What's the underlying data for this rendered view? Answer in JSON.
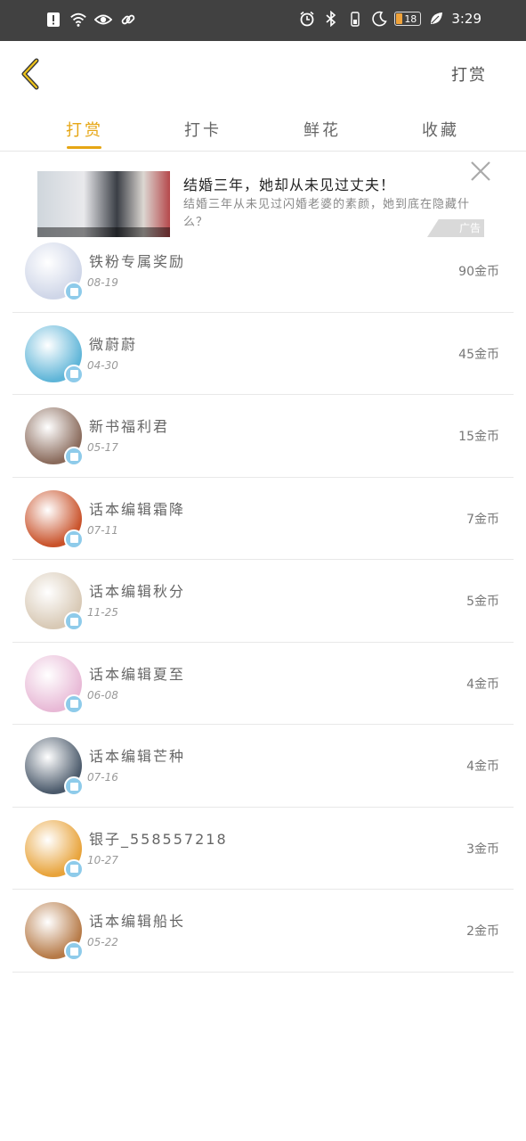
{
  "status_bar": {
    "battery": "18",
    "time": "3:29",
    "left_icons": [
      "alert-icon",
      "wifi-icon",
      "eye-icon",
      "link-icon"
    ],
    "right_icons": [
      "alarm-icon",
      "bluetooth-icon",
      "moon-icon",
      "leaf-icon"
    ]
  },
  "header": {
    "action_label": "打赏",
    "accent_color": "#e6a614"
  },
  "tabs": [
    {
      "label": "打赏",
      "active": true
    },
    {
      "label": "打卡",
      "active": false
    },
    {
      "label": "鲜花",
      "active": false
    },
    {
      "label": "收藏",
      "active": false
    }
  ],
  "ad": {
    "title": "结婚三年，她却从未见过丈夫！",
    "description": "结婚三年从未见过闪婚老婆的素颜，她到底在隐藏什么？",
    "badge": "广告"
  },
  "rewards": [
    {
      "name": "铁粉专属奖励",
      "date": "08-19",
      "amount": "90金币",
      "avatar_color": "#cfd6e8"
    },
    {
      "name": "微蔚蔚",
      "date": "04-30",
      "amount": "45金币",
      "avatar_color": "#5fb5d8"
    },
    {
      "name": "新书福利君",
      "date": "05-17",
      "amount": "15金币",
      "avatar_color": "#8a6b5c"
    },
    {
      "name": "话本编辑霜降",
      "date": "07-11",
      "amount": "7金币",
      "avatar_color": "#c9522a"
    },
    {
      "name": "话本编辑秋分",
      "date": "11-25",
      "amount": "5金币",
      "avatar_color": "#d8c9b5"
    },
    {
      "name": "话本编辑夏至",
      "date": "06-08",
      "amount": "4金币",
      "avatar_color": "#e8b9d6"
    },
    {
      "name": "话本编辑芒种",
      "date": "07-16",
      "amount": "4金币",
      "avatar_color": "#4b5a6b"
    },
    {
      "name": "银子_558557218",
      "date": "10-27",
      "amount": "3金币",
      "avatar_color": "#e8a33a"
    },
    {
      "name": "话本编辑船长",
      "date": "05-22",
      "amount": "2金币",
      "avatar_color": "#b67a47"
    }
  ]
}
